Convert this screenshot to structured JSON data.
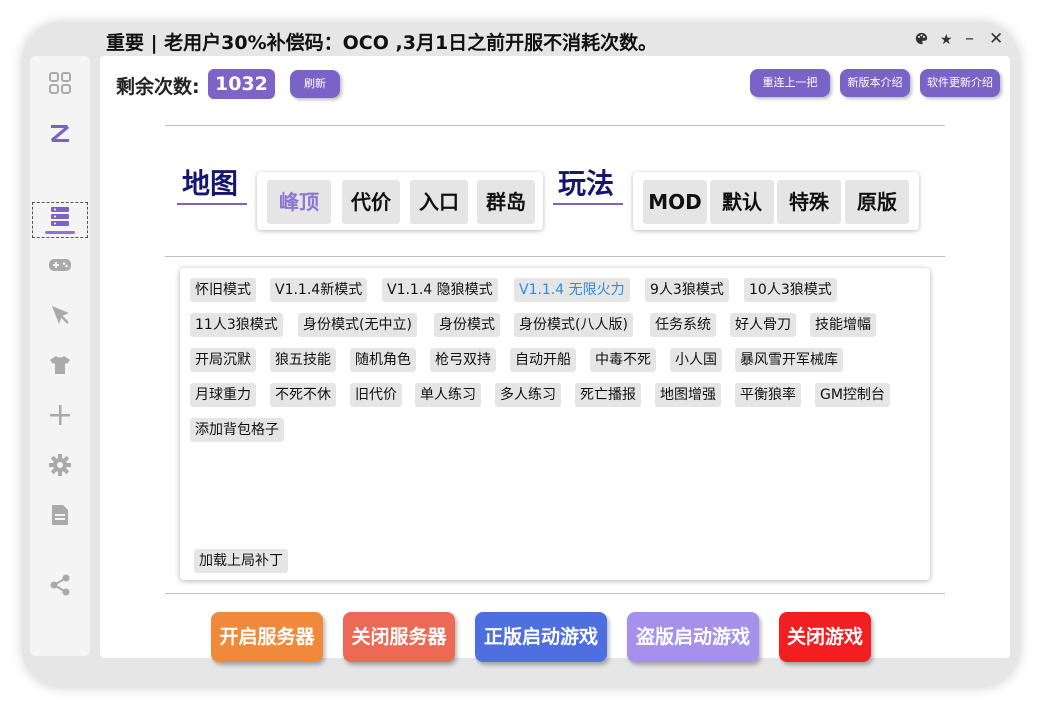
{
  "notice": "重要 | 老用户30%补偿码：OCO ,3月1日之前开服不消耗次数。",
  "window_controls": [
    "palette-icon",
    "star-icon",
    "minimize-icon",
    "close-icon"
  ],
  "sidebar": [
    "apps-icon",
    "logo-z-icon",
    "server-list-icon",
    "gamepad-icon",
    "pin-icon",
    "shirt-icon",
    "plus-icon",
    "gear-icon",
    "document-icon",
    "share-icon"
  ],
  "remaining": {
    "label": "剩余次数:",
    "value": "1032"
  },
  "buttons": {
    "refresh": "刷新",
    "reconnect": "重连上一把",
    "new_version": "新版本介绍",
    "software_update": "软件更新介绍"
  },
  "map_section": {
    "title": "地图",
    "tabs": [
      "峰顶",
      "代价",
      "入口",
      "群岛"
    ],
    "selected": "峰顶"
  },
  "mode_section": {
    "title": "玩法",
    "tabs": [
      "MOD",
      "默认",
      "特殊",
      "原版"
    ]
  },
  "options": [
    "怀旧模式",
    "V1.1.4新模式",
    "V1.1.4 隐狼模式",
    "V1.1.4 无限火力",
    "9人3狼模式",
    "10人3狼模式",
    "11人3狼模式",
    "身份模式(无中立)",
    "身份模式",
    "身份模式(八人版)",
    "任务系统",
    "好人骨刀",
    "技能增幅",
    "开局沉默",
    "狼五技能",
    "随机角色",
    "枪弓双持",
    "自动开船",
    "中毒不死",
    "小人国",
    "暴风雪开军械库",
    "月球重力",
    "不死不休",
    "旧代价",
    "单人练习",
    "多人练习",
    "死亡播报",
    "地图增强",
    "平衡狼率",
    "GM控制台",
    "添加背包格子"
  ],
  "highlighted_option": "V1.1.4 无限火力",
  "patch_button": "加载上局补丁",
  "actions": [
    {
      "label": "开启服务器",
      "color": "#f08a3a"
    },
    {
      "label": "关闭服务器",
      "color": "#ec6a55"
    },
    {
      "label": "正版启动游戏",
      "color": "#4f6fe0"
    },
    {
      "label": "盗版启动游戏",
      "color": "#a591ec"
    },
    {
      "label": "关闭游戏",
      "color": "#f21e22"
    }
  ],
  "colors": {
    "accent": "#7a63c6",
    "title_navy": "#17166e",
    "highlight_blue": "#2a8ce0"
  }
}
